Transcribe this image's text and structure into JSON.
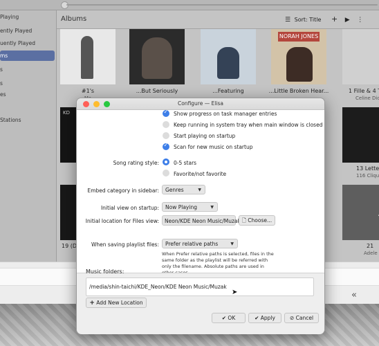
{
  "sidebar": {
    "items": [
      {
        "label": "Playing",
        "active": false
      },
      {
        "label": "ently Played",
        "active": false
      },
      {
        "label": "uently Played",
        "active": false
      },
      {
        "label": "ms",
        "active": true
      },
      {
        "label": "s",
        "active": false
      },
      {
        "label": "s",
        "active": false
      },
      {
        "label": "es",
        "active": false
      },
      {
        "label": "Stations",
        "active": false
      }
    ]
  },
  "albums_view": {
    "title": "Albums",
    "sort_label": "Sort: Title",
    "albums": [
      {
        "title": "#1's",
        "artist": "Ma",
        "art": "#ececec"
      },
      {
        "title": "...But Seriously",
        "artist": "",
        "art": "#2a2a2a"
      },
      {
        "title": "...Featuring",
        "artist": "",
        "art": "#b8c8d6"
      },
      {
        "title": "...Little Broken Hear...",
        "artist": "",
        "art": "#c9b79b"
      },
      {
        "title": "1 Fille & 4 T",
        "artist": "Celine Dio",
        "art": "#c8c8c8"
      },
      {
        "title": "",
        "artist": "",
        "art": "#111111"
      },
      {
        "title": "13 Letter",
        "artist": "116 Cliqu",
        "art": "#1b1b1b"
      },
      {
        "title": "",
        "artist": "",
        "art": "#141414"
      },
      {
        "title": "19 (D",
        "artist": "",
        "art": "#1a1a1a"
      },
      {
        "title": "21",
        "artist": "Adele",
        "art": "#555555"
      }
    ]
  },
  "dialog": {
    "title": "Configure — Elisa",
    "checkboxes": [
      {
        "label": "Show progress on task manager entries",
        "checked": true
      },
      {
        "label": "Keep running in system tray when main window is closed",
        "checked": false
      },
      {
        "label": "Start playing on startup",
        "checked": false
      },
      {
        "label": "Scan for new music on startup",
        "checked": true
      }
    ],
    "rating_label": "Song rating style:",
    "rating_options": [
      {
        "label": "0-5 stars",
        "selected": true
      },
      {
        "label": "Favorite/not favorite",
        "selected": false
      }
    ],
    "embed_label": "Embed category in sidebar:",
    "embed_value": "Genres",
    "initial_view_label": "Initial view on startup:",
    "initial_view_value": "Now Playing",
    "files_view_label": "Initial location for Files view:",
    "files_view_path": "Neon/KDE Neon Music/Muzak/",
    "choose_label": "Choose...",
    "playlist_label": "When saving playlist files:",
    "playlist_value": "Prefer relative paths",
    "playlist_help": "When Prefer relative paths is selected, files in the same folder as the playlist will be referred with only the filename. Absolute paths are used in other cases.",
    "music_folders_label": "Music folders:",
    "music_folder": "/media/shin-taichi/KDE_Neon/KDE Neon Music/Muzak",
    "add_location_label": "Add New Location",
    "ok_label": "OK",
    "apply_label": "Apply",
    "cancel_label": "Cancel"
  },
  "colors": {
    "accent": "#3d7ee8",
    "sidebar_active": "#5b6fa2"
  }
}
